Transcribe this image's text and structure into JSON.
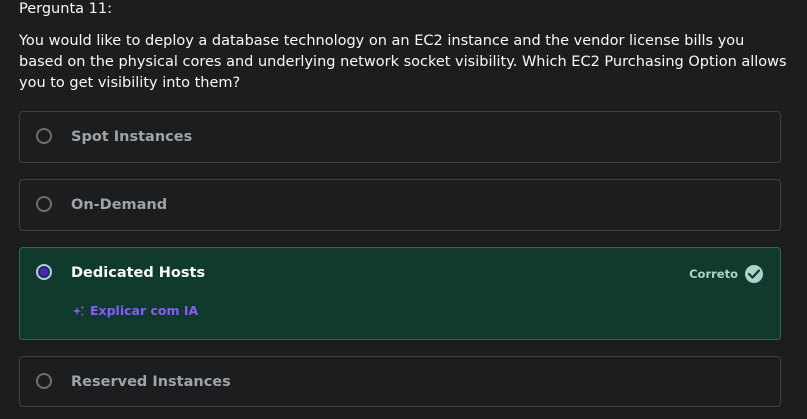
{
  "question": {
    "label": "Pergunta 11:",
    "text": "You would like to deploy a database technology on an EC2 instance and the vendor license bills you based on the physical cores and underlying network socket visibility. Which EC2 Purchasing Option allows you to get visibility into them?"
  },
  "options": [
    {
      "label": "Spot Instances",
      "selected": false
    },
    {
      "label": "On-Demand",
      "selected": false
    },
    {
      "label": "Dedicated Hosts",
      "selected": true
    },
    {
      "label": "Reserved Instances",
      "selected": false
    }
  ],
  "feedback": {
    "status": "Correto",
    "explain_label": "Explicar com IA"
  },
  "colors": {
    "background": "#1c1d1f",
    "correct_bg": "#0f3a2c",
    "correct_border": "#2a6b50",
    "accent": "#8a5cf5",
    "correct_text": "#acd2cc"
  },
  "icons": {
    "status": "check-circle-icon",
    "explain": "sparkle-icon"
  }
}
